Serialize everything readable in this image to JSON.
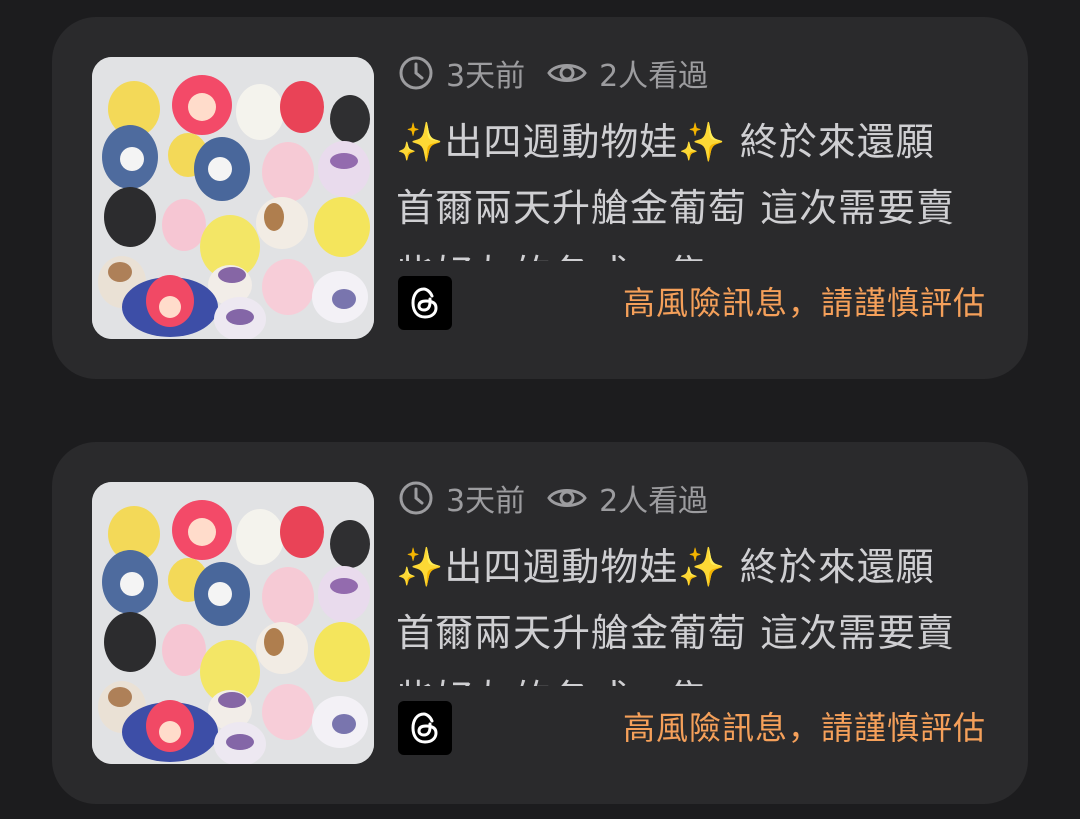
{
  "listings": [
    {
      "time_ago": "3天前",
      "views": "2人看過",
      "title": "✨出四週動物娃✨ 終於來還願首爾兩天升艙金葡萄 這次需要賣些好友的各式一隻",
      "source_icon": "threads-icon",
      "warning": "高風險訊息，請謹慎評估",
      "warning_color": "#f5a05a"
    },
    {
      "time_ago": "3天前",
      "views": "2人看過",
      "title": "✨出四週動物娃✨ 終於來還願首爾兩天升艙金葡萄 這次需要賣些好友的各式一隻",
      "source_icon": "threads-icon",
      "warning": "高風險訊息，請謹慎評估",
      "warning_color": "#f5a05a"
    }
  ]
}
